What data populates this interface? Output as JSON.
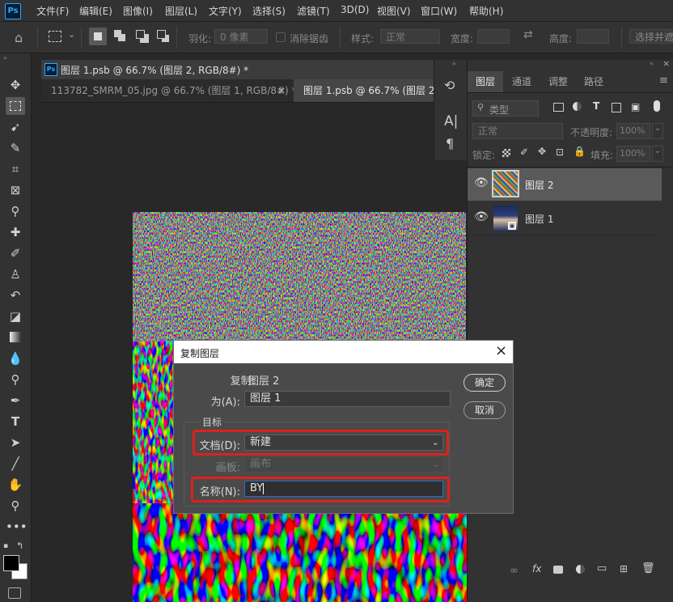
{
  "app": {
    "logo": "Ps"
  },
  "menu": [
    "文件(F)",
    "编辑(E)",
    "图像(I)",
    "图层(L)",
    "文字(Y)",
    "选择(S)",
    "滤镜(T)",
    "3D(D)",
    "视图(V)",
    "窗口(W)",
    "帮助(H)"
  ],
  "options_bar": {
    "feather_label": "羽化:",
    "feather_value": "0 像素",
    "antialias_label": "消除锯齿",
    "style_label": "样式:",
    "style_value": "正常",
    "width_label": "宽度:",
    "height_label": "高度:",
    "select_mask_label": "选择并遮"
  },
  "document": {
    "title": "图层 1.psb @ 66.7% (图层 2, RGB/8#) *",
    "tabs": [
      {
        "label": "113782_SMRM_05.jpg @ 66.7% (图层 1, RGB/8#) *",
        "active": false
      },
      {
        "label": "图层 1.psb @ 66.7% (图层 2, I",
        "active": true
      }
    ]
  },
  "layers_panel": {
    "tabs": [
      "图层",
      "通道",
      "调整",
      "路径"
    ],
    "filter_label": "类型",
    "blend_mode": "正常",
    "opacity_label": "不透明度:",
    "opacity_value": "100%",
    "lock_label": "锁定:",
    "fill_label": "填充:",
    "fill_value": "100%",
    "layers": [
      {
        "name": "图层 2",
        "visible": true,
        "selected": true
      },
      {
        "name": "图层 1",
        "visible": true,
        "selected": false
      }
    ]
  },
  "dialog": {
    "title": "复制图层",
    "source_label": "复制:",
    "source_value": "图层 2",
    "as_label": "为(A):",
    "as_value": "图层 1",
    "destination_label": "目标",
    "document_label": "文档(D):",
    "document_value": "新建",
    "artboard_label": "画板:",
    "artboard_value": "画布",
    "name_label": "名称(N):",
    "name_value": "BY",
    "ok_label": "确定",
    "cancel_label": "取消"
  },
  "colors": {
    "highlight": "#e0201b",
    "accent": "#31a8ff"
  }
}
